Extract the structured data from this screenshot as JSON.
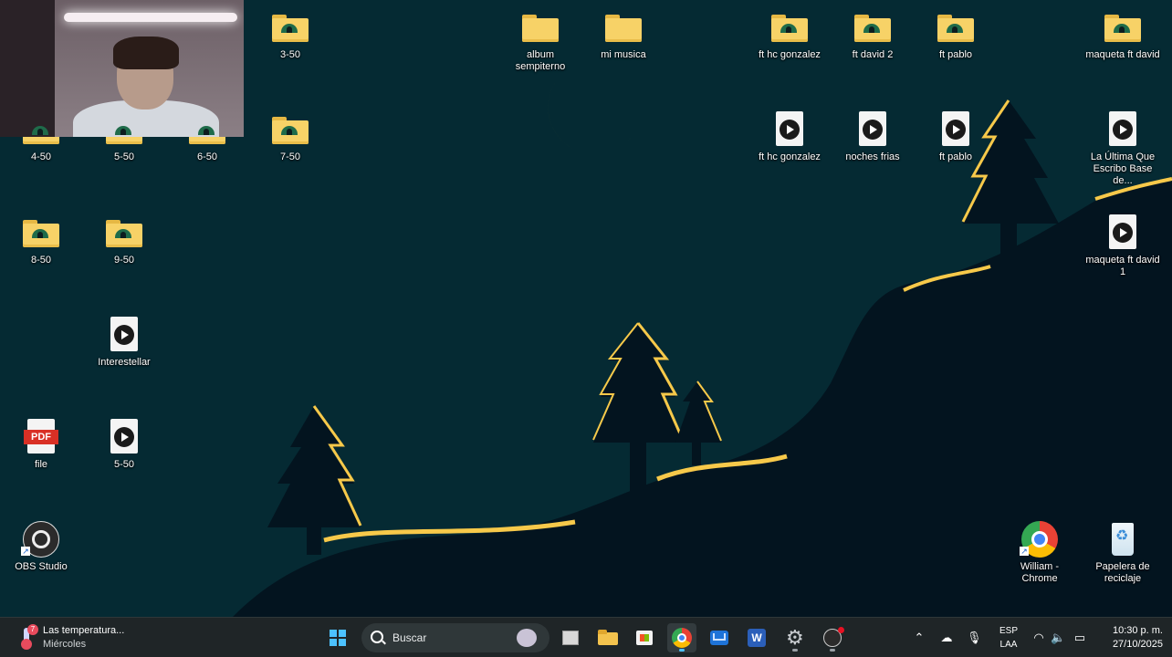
{
  "desktop": {
    "icons": [
      {
        "id": "folder-3-50",
        "label": "3-50"
      },
      {
        "id": "folder-album",
        "label": "album sempiterno"
      },
      {
        "id": "folder-mi-musica",
        "label": "mi musica"
      },
      {
        "id": "folder-ft-hc",
        "label": "ft hc gonzalez"
      },
      {
        "id": "folder-ft-david-2",
        "label": "ft david 2"
      },
      {
        "id": "folder-ft-pablo",
        "label": "ft pablo"
      },
      {
        "id": "folder-maqueta",
        "label": "maqueta ft david"
      },
      {
        "id": "folder-4-50",
        "label": "4-50"
      },
      {
        "id": "folder-5-50",
        "label": "5-50"
      },
      {
        "id": "folder-6-50",
        "label": "6-50"
      },
      {
        "id": "folder-7-50",
        "label": "7-50"
      },
      {
        "id": "media-ft-hc",
        "label": "ft hc gonzalez"
      },
      {
        "id": "media-noches",
        "label": "noches frias"
      },
      {
        "id": "media-ft-pablo",
        "label": "ft pablo"
      },
      {
        "id": "media-ultima",
        "label": "La Última Que Escribo Base de..."
      },
      {
        "id": "media-maqueta-1",
        "label": "maqueta ft david 1"
      },
      {
        "id": "folder-8-50",
        "label": "8-50"
      },
      {
        "id": "folder-9-50",
        "label": "9-50"
      },
      {
        "id": "media-interestellar",
        "label": "Interestellar"
      },
      {
        "id": "pdf-file",
        "label": "file"
      },
      {
        "id": "media-5-50",
        "label": "5-50"
      },
      {
        "id": "app-obs",
        "label": "OBS Studio"
      },
      {
        "id": "app-chrome",
        "label": "William - Chrome"
      },
      {
        "id": "app-recycle",
        "label": "Papelera de reciclaje"
      }
    ],
    "pdf_badge": "PDF"
  },
  "taskbar": {
    "weather_title": "Las temperatura...",
    "weather_subtitle": "Miércoles",
    "weather_badge": "7",
    "search_placeholder": "Buscar",
    "language_top": "ESP",
    "language_bottom": "LAA",
    "time": "10:30 p. m.",
    "date": "27/10/2025"
  },
  "colors": {
    "wallpaper_sky": "#052a33",
    "hill": "#03141f",
    "moon": "#f7b93a",
    "taskbar": "#1f2527",
    "accent": "#4cc2ff"
  }
}
